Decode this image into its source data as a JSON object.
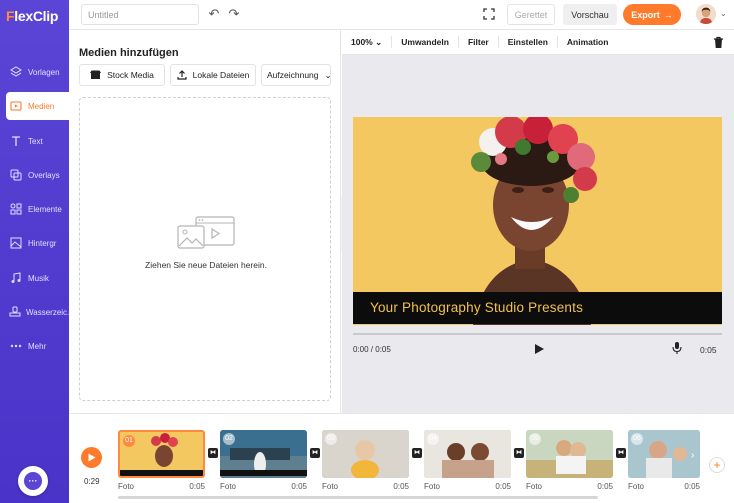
{
  "app": {
    "logo_prefix": "F",
    "logo_rest": "lexClip"
  },
  "sidebar": {
    "items": [
      {
        "label": "Vorlagen",
        "icon": "layers-icon"
      },
      {
        "label": "Medien",
        "icon": "media-folder-icon",
        "active": true
      },
      {
        "label": "Text",
        "icon": "text-icon"
      },
      {
        "label": "Overlays",
        "icon": "overlays-icon"
      },
      {
        "label": "Elemente",
        "icon": "elements-icon"
      },
      {
        "label": "Hintergr",
        "icon": "background-icon"
      },
      {
        "label": "Musik",
        "icon": "music-icon"
      },
      {
        "label": "Wasserzeic...",
        "icon": "watermark-icon"
      },
      {
        "label": "Mehr",
        "icon": "more-dots-icon"
      }
    ],
    "chat_icon": "chat-icon"
  },
  "topbar": {
    "title_value": "Untitled",
    "saved_label": "Gerettet",
    "preview_label": "Vorschau",
    "export_label": "Export"
  },
  "media_panel": {
    "title": "Medien hinzufügen",
    "stock_label": "Stock Media",
    "local_label": "Lokale Dateien",
    "record_label": "Aufzeichnung",
    "drop_text": "Ziehen Sie neue Dateien herein."
  },
  "editbar": {
    "zoom": "100%",
    "items": [
      "Umwandeln",
      "Filter",
      "Einstellen",
      "Animation"
    ]
  },
  "stage": {
    "caption": "Your Photography Studio Presents",
    "time": "0:00 / 0:05",
    "duration": "0:05"
  },
  "timeline": {
    "current_time": "0:29",
    "clips": [
      {
        "num": "01",
        "label": "Foto",
        "duration": "0:05",
        "selected": true
      },
      {
        "num": "02",
        "label": "Foto",
        "duration": "0:05"
      },
      {
        "num": "03",
        "label": "Foto",
        "duration": "0:05"
      },
      {
        "num": "04",
        "label": "Foto",
        "duration": "0:05"
      },
      {
        "num": "05",
        "label": "Foto",
        "duration": "0:05"
      },
      {
        "num": "06",
        "label": "Foto",
        "duration": "0:05"
      }
    ]
  },
  "colors": {
    "accent": "#ff7a2a",
    "sidebar": "#5a45d6",
    "caption_text": "#f2c14e"
  }
}
